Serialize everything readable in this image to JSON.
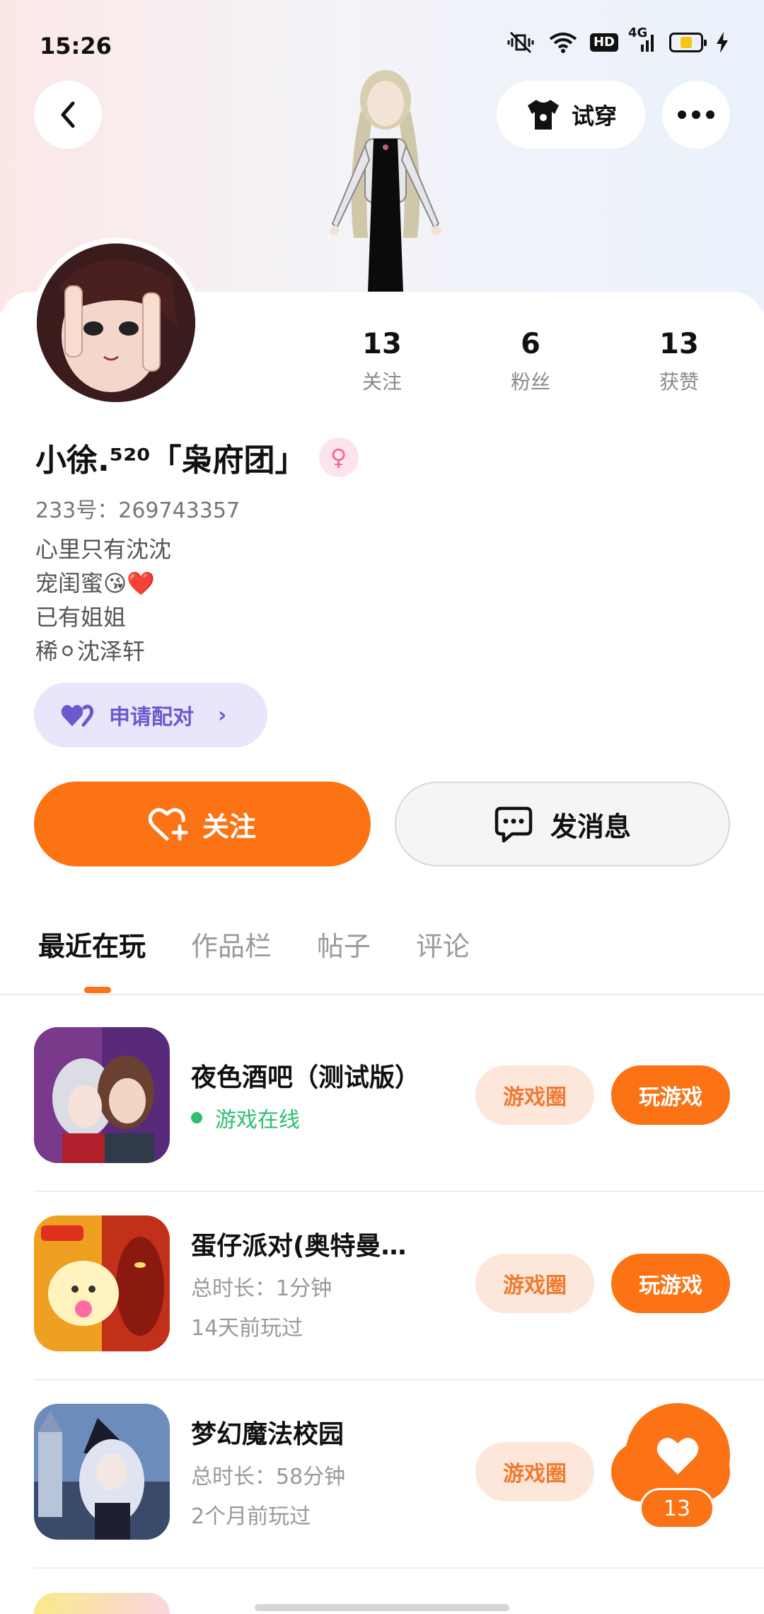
{
  "status_bar": {
    "time": "15:26",
    "hd": "HD",
    "network": "4G",
    "battery_level": 0.45
  },
  "header": {
    "try_on_label": "试穿"
  },
  "profile": {
    "stats": [
      {
        "value": "13",
        "label": "关注"
      },
      {
        "value": "6",
        "label": "粉丝"
      },
      {
        "value": "13",
        "label": "获赞"
      }
    ],
    "nickname": "小徐.⁵²⁰「枭府团」",
    "gender_symbol": "♀",
    "uid": "233号：269743357",
    "bio": [
      "心里只有沈沈",
      "宠闺蜜😘❤️",
      "已有姐姐",
      "稀⚪沈泽轩"
    ],
    "pair_label": "申请配对",
    "pair_chevron": "›"
  },
  "actions": {
    "follow_label": "关注",
    "message_label": "发消息"
  },
  "tabs": [
    {
      "label": "最近在玩",
      "active": true
    },
    {
      "label": "作品栏",
      "active": false
    },
    {
      "label": "帖子",
      "active": false
    },
    {
      "label": "评论",
      "active": false
    }
  ],
  "games": [
    {
      "title": "夜色酒吧（测试版）",
      "status": "游戏在线",
      "circle_label": "游戏圈",
      "play_label": "玩游戏"
    },
    {
      "title": "蛋仔派对(奥特曼…",
      "duration": "总时长：1分钟",
      "last_played": "14天前玩过",
      "circle_label": "游戏圈",
      "play_label": "玩游戏"
    },
    {
      "title": "梦幻魔法校园",
      "duration": "总时长：58分钟",
      "last_played": "2个月前玩过",
      "circle_label": "游戏圈",
      "play_label": "玩游戏"
    }
  ],
  "like_fab": {
    "count": "13"
  },
  "colors": {
    "accent": "#fb7314",
    "online": "#2bbf72",
    "pair": "#6a5acd"
  }
}
